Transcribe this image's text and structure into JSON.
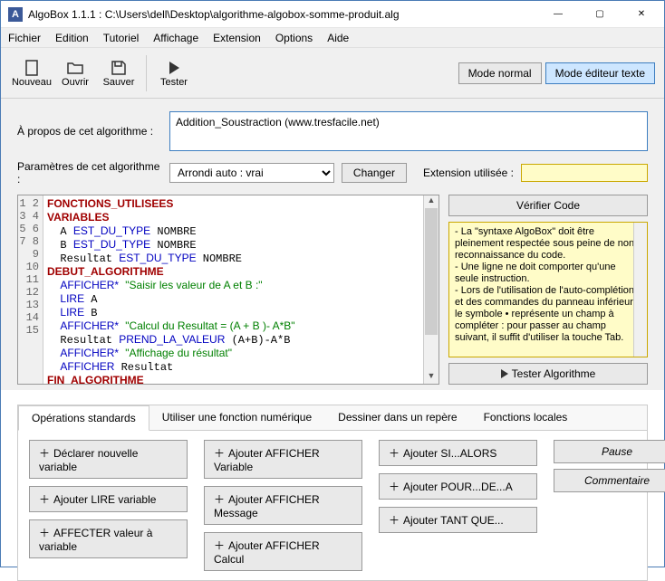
{
  "window": {
    "app_icon_letter": "A",
    "title": "AlgoBox 1.1.1 : C:\\Users\\dell\\Desktop\\algorithme-algobox-somme-produit.alg",
    "min": "—",
    "max": "▢",
    "close": "✕"
  },
  "menu": {
    "fichier": "Fichier",
    "edition": "Edition",
    "tutoriel": "Tutoriel",
    "affichage": "Affichage",
    "extension": "Extension",
    "options": "Options",
    "aide": "Aide"
  },
  "toolbar": {
    "nouveau": "Nouveau",
    "ouvrir": "Ouvrir",
    "sauver": "Sauver",
    "tester": "Tester",
    "mode_normal": "Mode normal",
    "mode_editeur": "Mode éditeur texte"
  },
  "about": {
    "label": "À propos de cet algorithme :",
    "value": "Addition_Soustraction (www.tresfacile.net)"
  },
  "params": {
    "label": "Paramètres de cet algorithme :",
    "selected": "Arrondi auto : vrai",
    "changer": "Changer",
    "ext_label": "Extension utilisée :",
    "ext_value": ""
  },
  "code": {
    "line_count": 15,
    "lines": [
      {
        "n": 1,
        "html": "<span class='kw-red'>FONCTIONS_UTILISEES</span>"
      },
      {
        "n": 2,
        "html": "<span class='kw-red'>VARIABLES</span>"
      },
      {
        "n": 3,
        "html": "  A <span class='kw-blue'>EST_DU_TYPE</span> NOMBRE"
      },
      {
        "n": 4,
        "html": "  B <span class='kw-blue'>EST_DU_TYPE</span> NOMBRE"
      },
      {
        "n": 5,
        "html": "  Resultat <span class='kw-blue'>EST_DU_TYPE</span> NOMBRE"
      },
      {
        "n": 6,
        "html": "<span class='kw-red'>DEBUT_ALGORITHME</span>"
      },
      {
        "n": 7,
        "html": "  <span class='kw-blue'>AFFICHER*</span> <span class='str'>\"Saisir les valeur de A et B :\"</span>"
      },
      {
        "n": 8,
        "html": "  <span class='kw-blue'>LIRE</span> A"
      },
      {
        "n": 9,
        "html": "  <span class='kw-blue'>LIRE</span> B"
      },
      {
        "n": 10,
        "html": "  <span class='kw-blue'>AFFICHER*</span> <span class='str'>\"Calcul du Resultat = (A + B )- A*B\"</span>"
      },
      {
        "n": 11,
        "html": "  Resultat <span class='kw-blue'>PREND_LA_VALEUR</span> (A+B)-A*B"
      },
      {
        "n": 12,
        "html": "  <span class='kw-blue'>AFFICHER*</span> <span class='str'>\"Affichage du résultat\"</span>"
      },
      {
        "n": 13,
        "html": "  <span class='kw-blue'>AFFICHER</span> Resultat"
      },
      {
        "n": 14,
        "html": "<span class='kw-red'>FIN_ALGORITHME</span>"
      },
      {
        "n": 15,
        "html": ""
      }
    ]
  },
  "right": {
    "verify": "Vérifier Code",
    "help": "- La \"syntaxe AlgoBox\" doit être pleinement respectée sous peine de non-reconnaissance du code.\n- Une ligne ne doit comporter qu'une seule instruction.\n- Lors de l'utilisation de l'auto-complétion et des commandes du panneau inférieur, le symbole • représente un champ à compléter : pour passer au champ suivant, il suffit d'utiliser la touche Tab.",
    "test": "Tester Algorithme"
  },
  "tabs": {
    "t1": "Opérations standards",
    "t2": "Utiliser une fonction numérique",
    "t3": "Dessiner dans un repère",
    "t4": "Fonctions locales"
  },
  "ops": {
    "declare_var": "Déclarer nouvelle variable",
    "lire_var": "Ajouter LIRE variable",
    "affecter": "AFFECTER valeur à variable",
    "afficher_var": "Ajouter AFFICHER Variable",
    "afficher_msg": "Ajouter AFFICHER Message",
    "afficher_calc": "Ajouter AFFICHER Calcul",
    "si_alors": "Ajouter SI...ALORS",
    "pour_de_a": "Ajouter POUR...DE...A",
    "tant_que": "Ajouter TANT QUE...",
    "pause": "Pause",
    "commentaire": "Commentaire"
  }
}
